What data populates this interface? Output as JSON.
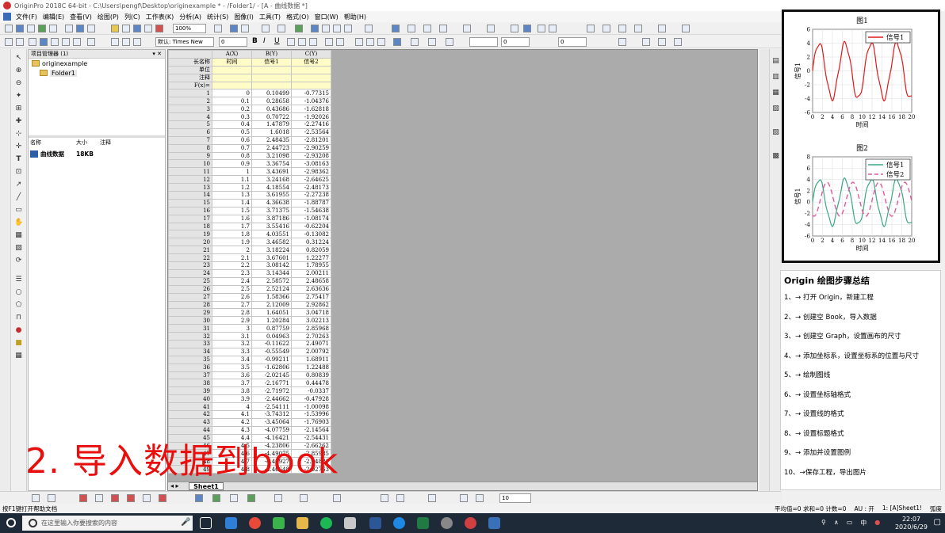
{
  "window": {
    "title": "OriginPro 2018C 64-bit - C:\\Users\\pengf\\Desktop\\originexample * - /Folder1/ - [A - 曲线数据 *]"
  },
  "menu": [
    "文件(F)",
    "编辑(E)",
    "查看(V)",
    "绘图(P)",
    "列(C)",
    "工作表(K)",
    "分析(A)",
    "统计(S)",
    "图像(I)",
    "工具(T)",
    "格式(O)",
    "窗口(W)",
    "帮助(H)"
  ],
  "toolbar": {
    "zoom": "100%",
    "font_name": "默认: Times New",
    "font_size": "0",
    "bold": "B",
    "italic": "I",
    "underline": "U",
    "line_width": "0",
    "bottom_font_size": "10"
  },
  "project_explorer": {
    "title": "项目管理器 (1)",
    "root": "originexample",
    "folder": "Folder1",
    "columns": [
      "名称",
      "大小",
      "注释"
    ],
    "items": [
      {
        "name": "曲线数据",
        "size": "18KB",
        "note": ""
      }
    ]
  },
  "worksheet": {
    "corner": "",
    "columns": [
      {
        "header": "A(X)",
        "long_name": "时间",
        "unit": "",
        "comment": ""
      },
      {
        "header": "B(Y)",
        "long_name": "信号1",
        "unit": "",
        "comment": ""
      },
      {
        "header": "C(Y)",
        "long_name": "信号2",
        "unit": "",
        "comment": ""
      }
    ],
    "meta_labels": [
      "长名称",
      "单位",
      "注释",
      "F(x)="
    ],
    "rows": [
      [
        "1",
        "0",
        "0.10499",
        "-0.77315"
      ],
      [
        "2",
        "0.1",
        "0.28658",
        "-1.04376"
      ],
      [
        "3",
        "0.2",
        "0.43686",
        "-1.62818"
      ],
      [
        "4",
        "0.3",
        "0.70722",
        "-1.92026"
      ],
      [
        "5",
        "0.4",
        "1.47879",
        "-2.27416"
      ],
      [
        "6",
        "0.5",
        "1.6018",
        "-2.53564"
      ],
      [
        "7",
        "0.6",
        "2.48435",
        "-2.81201"
      ],
      [
        "8",
        "0.7",
        "2.44723",
        "-2.90259"
      ],
      [
        "9",
        "0.8",
        "3.21098",
        "-2.93208"
      ],
      [
        "10",
        "0.9",
        "3.36754",
        "-3.08163"
      ],
      [
        "11",
        "1",
        "3.43691",
        "-2.98362"
      ],
      [
        "12",
        "1.1",
        "3.24168",
        "-2.64625"
      ],
      [
        "13",
        "1.2",
        "4.18554",
        "-2.48173"
      ],
      [
        "14",
        "1.3",
        "3.61955",
        "-2.27238"
      ],
      [
        "15",
        "1.4",
        "4.36638",
        "-1.88787"
      ],
      [
        "16",
        "1.5",
        "3.71375",
        "-1.54638"
      ],
      [
        "17",
        "1.6",
        "3.87186",
        "-1.08174"
      ],
      [
        "18",
        "1.7",
        "3.55416",
        "-0.62204"
      ],
      [
        "19",
        "1.8",
        "4.03551",
        "-0.13082"
      ],
      [
        "20",
        "1.9",
        "3.46582",
        "0.31224"
      ],
      [
        "21",
        "2",
        "3.18224",
        "0.82059"
      ],
      [
        "22",
        "2.1",
        "3.67601",
        "1.22277"
      ],
      [
        "23",
        "2.2",
        "3.08142",
        "1.78955"
      ],
      [
        "24",
        "2.3",
        "3.14344",
        "2.00211"
      ],
      [
        "25",
        "2.4",
        "2.58572",
        "2.48658"
      ],
      [
        "26",
        "2.5",
        "2.52124",
        "2.63636"
      ],
      [
        "27",
        "2.6",
        "1.58366",
        "2.75417"
      ],
      [
        "28",
        "2.7",
        "2.12009",
        "2.92862"
      ],
      [
        "29",
        "2.8",
        "1.64051",
        "3.04718"
      ],
      [
        "30",
        "2.9",
        "1.20284",
        "3.02213"
      ],
      [
        "31",
        "3",
        "0.87759",
        "2.85968"
      ],
      [
        "32",
        "3.1",
        "0.04963",
        "2.70263"
      ],
      [
        "33",
        "3.2",
        "-0.11622",
        "2.49071"
      ],
      [
        "34",
        "3.3",
        "-0.55549",
        "2.00792"
      ],
      [
        "35",
        "3.4",
        "-0.99211",
        "1.68911"
      ],
      [
        "36",
        "3.5",
        "-1.62806",
        "1.22488"
      ],
      [
        "37",
        "3.6",
        "-2.02145",
        "0.80839"
      ],
      [
        "38",
        "3.7",
        "-2.16771",
        "0.44478"
      ],
      [
        "39",
        "3.8",
        "-2.71972",
        "-0.0337"
      ],
      [
        "40",
        "3.9",
        "-2.44662",
        "-0.47928"
      ],
      [
        "41",
        "4",
        "-2.54111",
        "-1.00098"
      ],
      [
        "42",
        "4.1",
        "-3.74312",
        "-1.53996"
      ],
      [
        "43",
        "4.2",
        "-3.45064",
        "-1.76903"
      ],
      [
        "44",
        "4.3",
        "-4.07759",
        "-2.14564"
      ],
      [
        "45",
        "4.4",
        "-4.16421",
        "-2.54431"
      ],
      [
        "46",
        "4.5",
        "-4.23806",
        "-2.66262"
      ],
      [
        "47",
        "4.6",
        "-4.49075",
        "-2.85985"
      ],
      [
        "48",
        "4.7",
        "-4.46927",
        "-2.94881"
      ],
      [
        "49",
        "4.8",
        "-4.46648",
        "-2.92763"
      ]
    ],
    "sheet_tab": "Sheet1"
  },
  "graph_panel": {
    "charts": [
      {
        "title": "图1",
        "xlabel": "时间",
        "ylabel": "信号1",
        "xticks": [
          "0",
          "2",
          "4",
          "6",
          "8",
          "10",
          "12",
          "14",
          "16",
          "18",
          "20"
        ],
        "yticks": [
          "6",
          "4",
          "2",
          "0",
          "-2",
          "-4",
          "-6"
        ],
        "legend": [
          "信号1"
        ]
      },
      {
        "title": "图2",
        "xlabel": "时间",
        "ylabel": "信号1",
        "xticks": [
          "0",
          "2",
          "4",
          "6",
          "8",
          "10",
          "12",
          "14",
          "16",
          "18",
          "20"
        ],
        "yticks": [
          "8",
          "6",
          "4",
          "2",
          "0",
          "-2",
          "-4",
          "-6"
        ],
        "legend": [
          "信号1",
          "信号2"
        ]
      }
    ],
    "colors": {
      "signal1": "#e01818",
      "signal1_b": "#3aa882",
      "signal2": "#e05aa0"
    }
  },
  "summary": {
    "title": "Origin 绘图步骤总结",
    "steps": [
      "1、→ 打开 Origin，新建工程",
      "2、→ 创建空 Book，导入数据",
      "3、→ 创建空 Graph，设置画布的尺寸",
      "4、→ 添加坐标系，设置坐标系的位置与尺寸",
      "5、→ 绘制图线",
      "6、→ 设置坐标轴格式",
      "7、→ 设置线的格式",
      "8、→ 设置标题格式",
      "9、→ 添加并设置图例",
      "10、→保存工程，导出图片"
    ]
  },
  "overlay_caption": "2. 导入数据到book",
  "statusbar": {
    "left": "按F1键打开帮助文档",
    "stats": "平均值=0 求和=0 计数=0",
    "au": "AU : 开",
    "sheet": "1: [A]Sheet1!",
    "mode": "弧度"
  },
  "taskbar": {
    "search_placeholder": "在这里输入你要搜索的内容",
    "ime": "中",
    "time": "22:07",
    "date": "2020/6/29"
  }
}
